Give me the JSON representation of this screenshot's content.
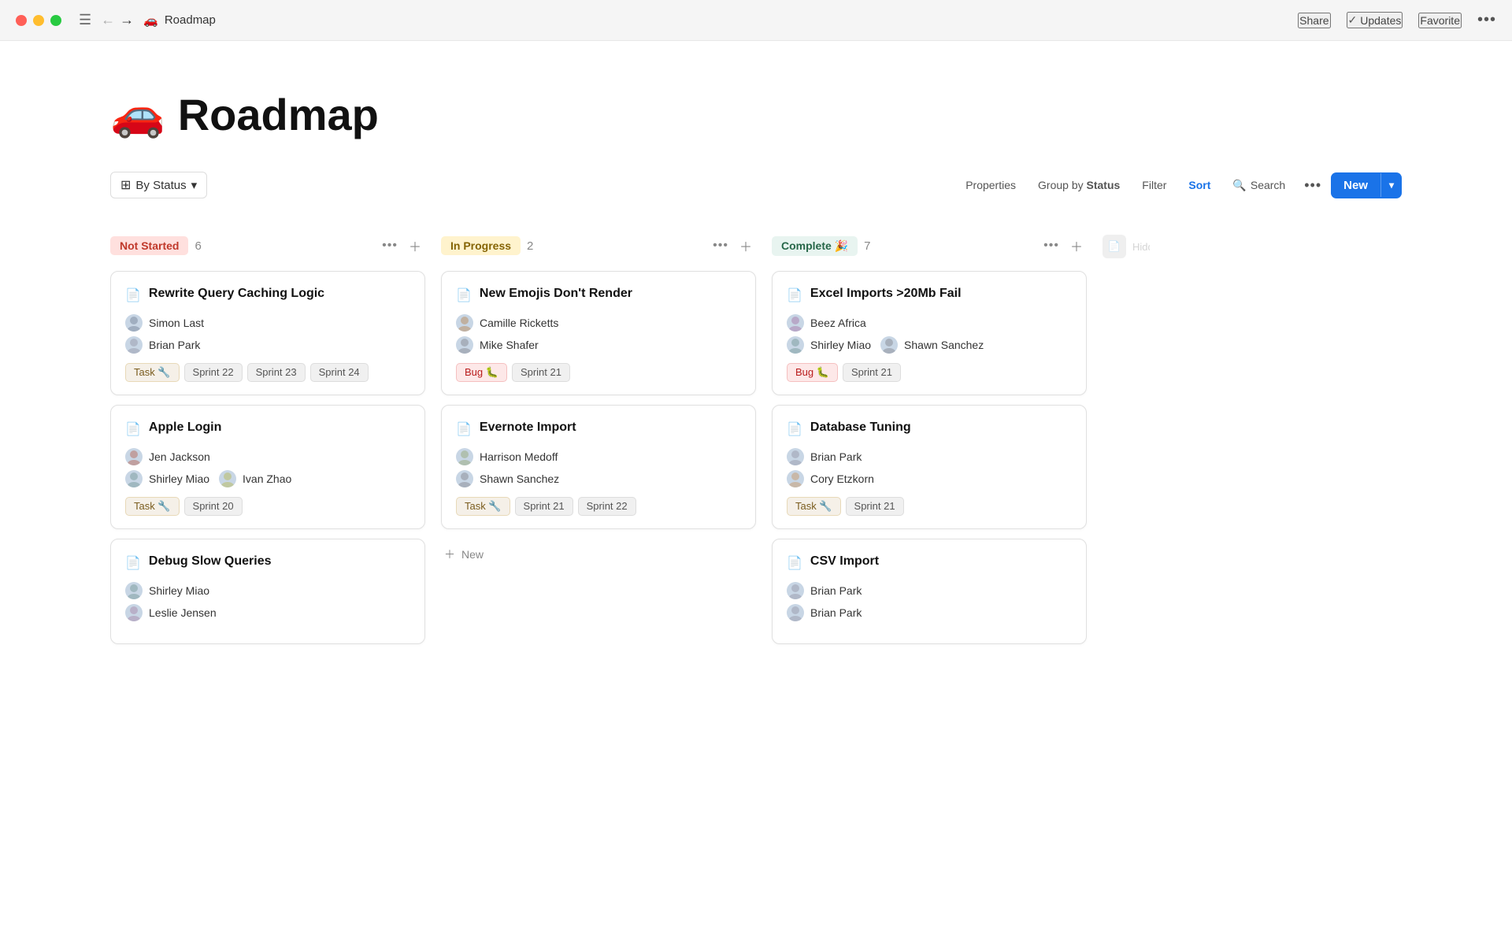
{
  "titlebar": {
    "page_title": "Roadmap",
    "page_emoji": "🚗",
    "share_label": "Share",
    "updates_label": "Updates",
    "favorite_label": "Favorite"
  },
  "page": {
    "heading_emoji": "🚗",
    "heading_title": "Roadmap"
  },
  "toolbar": {
    "by_status_label": "By Status",
    "properties_label": "Properties",
    "group_by_prefix": "Group by",
    "group_by_value": "Status",
    "filter_label": "Filter",
    "sort_label": "Sort",
    "search_label": "Search",
    "new_label": "New"
  },
  "columns": [
    {
      "id": "not-started",
      "status_label": "Not Started",
      "count": 6,
      "status_class": "status-not-started"
    },
    {
      "id": "in-progress",
      "status_label": "In Progress",
      "count": 2,
      "status_class": "status-in-progress"
    },
    {
      "id": "complete",
      "status_label": "Complete 🎉",
      "count": 7,
      "status_class": "status-complete"
    }
  ],
  "cards": {
    "not-started": [
      {
        "title": "Rewrite Query Caching Logic",
        "people": [
          "Simon Last",
          "Brian Park"
        ],
        "tags": [
          "Task 🔧",
          "Sprint 22",
          "Sprint 23",
          "Sprint 24"
        ],
        "tag_types": [
          "task",
          "sprint",
          "sprint",
          "sprint"
        ]
      },
      {
        "title": "Apple Login",
        "people": [
          "Jen Jackson",
          "Shirley Miao",
          "Ivan Zhao"
        ],
        "tags": [
          "Task 🔧",
          "Sprint 20"
        ],
        "tag_types": [
          "task",
          "sprint"
        ]
      },
      {
        "title": "Debug Slow Queries",
        "people": [
          "Shirley Miao",
          "Leslie Jensen"
        ],
        "tags": [],
        "tag_types": []
      }
    ],
    "in-progress": [
      {
        "title": "New Emojis Don't Render",
        "people": [
          "Camille Ricketts",
          "Mike Shafer"
        ],
        "tags": [
          "Bug 🐛",
          "Sprint 21"
        ],
        "tag_types": [
          "bug",
          "sprint"
        ]
      },
      {
        "title": "Evernote Import",
        "people": [
          "Harrison Medoff",
          "Shawn Sanchez"
        ],
        "tags": [
          "Task 🔧",
          "Sprint 21",
          "Sprint 22"
        ],
        "tag_types": [
          "task",
          "sprint",
          "sprint"
        ]
      }
    ],
    "complete": [
      {
        "title": "Excel Imports >20Mb Fail",
        "people": [
          "Beez Africa",
          "Shirley Miao",
          "Shawn Sanchez"
        ],
        "tags": [
          "Bug 🐛",
          "Sprint 21"
        ],
        "tag_types": [
          "bug",
          "sprint"
        ]
      },
      {
        "title": "Database Tuning",
        "people": [
          "Brian Park",
          "Cory Etzkorn"
        ],
        "tags": [
          "Task 🔧",
          "Sprint 21"
        ],
        "tag_types": [
          "task",
          "sprint"
        ]
      },
      {
        "title": "CSV Import",
        "people": [
          "Brian Park",
          "Brian Park"
        ],
        "tags": [],
        "tag_types": []
      }
    ]
  },
  "hidden_label": "Hidden"
}
